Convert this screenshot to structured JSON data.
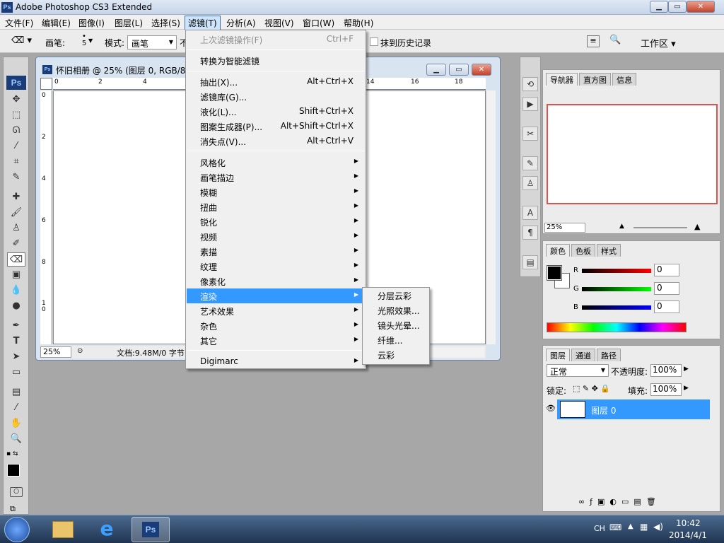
{
  "app": {
    "title": "Adobe Photoshop CS3 Extended",
    "logo": "Ps"
  },
  "window_controls": {
    "minimize_icon": "minimize-icon",
    "restore_icon": "restore-icon",
    "close_icon": "close-icon"
  },
  "menubar": [
    "文件(F)",
    "编辑(E)",
    "图像(I)",
    "图层(L)",
    "选择(S)",
    "滤镜(T)",
    "分析(A)",
    "视图(V)",
    "窗口(W)",
    "帮助(H)"
  ],
  "options_bar": {
    "brush_label": "画笔:",
    "brush_size": "5",
    "mode_label": "模式:",
    "mode_value": "画笔",
    "partial_label": "不",
    "history_text": "抹到历史记录",
    "workspace_label": "工作区 ▾"
  },
  "document": {
    "title": "怀旧相册 @ 25% (图层 0, RGB/8",
    "zoom": "25%",
    "status": "文档:9.48M/0 字节",
    "ruler_top_ticks": [
      "0",
      "2",
      "4",
      "14",
      "16",
      "18"
    ],
    "ruler_left_ticks": [
      "0",
      "2",
      "4",
      "6",
      "8",
      "1\n0"
    ]
  },
  "filter_menu": {
    "items": [
      {
        "label": "上次滤镜操作(F)",
        "shortcut": "Ctrl+F",
        "disabled": true
      },
      {
        "label": "转换为智能滤镜",
        "shortcut": ""
      },
      {
        "label": "抽出(X)...",
        "shortcut": "Alt+Ctrl+X"
      },
      {
        "label": "滤镜库(G)...",
        "shortcut": ""
      },
      {
        "label": "液化(L)...",
        "shortcut": "Shift+Ctrl+X"
      },
      {
        "label": "图案生成器(P)...",
        "shortcut": "Alt+Shift+Ctrl+X"
      },
      {
        "label": "消失点(V)...",
        "shortcut": "Alt+Ctrl+V"
      },
      {
        "label": "风格化",
        "submenu": true
      },
      {
        "label": "画笔描边",
        "submenu": true
      },
      {
        "label": "模糊",
        "submenu": true
      },
      {
        "label": "扭曲",
        "submenu": true
      },
      {
        "label": "锐化",
        "submenu": true
      },
      {
        "label": "视频",
        "submenu": true
      },
      {
        "label": "素描",
        "submenu": true
      },
      {
        "label": "纹理",
        "submenu": true
      },
      {
        "label": "像素化",
        "submenu": true
      },
      {
        "label": "渲染",
        "submenu": true,
        "highlighted": true
      },
      {
        "label": "艺术效果",
        "submenu": true
      },
      {
        "label": "杂色",
        "submenu": true
      },
      {
        "label": "其它",
        "submenu": true
      },
      {
        "label": "Digimarc",
        "submenu": true
      }
    ]
  },
  "render_submenu": [
    "分层云彩",
    "光照效果...",
    "镜头光晕...",
    "纤维...",
    "云彩"
  ],
  "navigator": {
    "tabs": [
      "导航器",
      "直方图",
      "信息"
    ],
    "zoom": "25%"
  },
  "color_panel": {
    "tabs": [
      "颜色",
      "色板",
      "样式"
    ],
    "r_label": "R",
    "g_label": "G",
    "b_label": "B",
    "r": "0",
    "g": "0",
    "b": "0"
  },
  "layers_panel": {
    "tabs": [
      "图层",
      "通道",
      "路径"
    ],
    "blend_mode": "正常",
    "opacity_label": "不透明度:",
    "opacity": "100%",
    "lock_label": "锁定:",
    "fill_label": "填充:",
    "fill": "100%",
    "layer_name": "图层 0"
  },
  "taskbar": {
    "ime": "CH",
    "time": "10:42",
    "date": "2014/4/1"
  },
  "colors": {
    "highlight": "#3399ff",
    "nav_frame": "#d9534f",
    "layer_selected": "#3399ff"
  }
}
